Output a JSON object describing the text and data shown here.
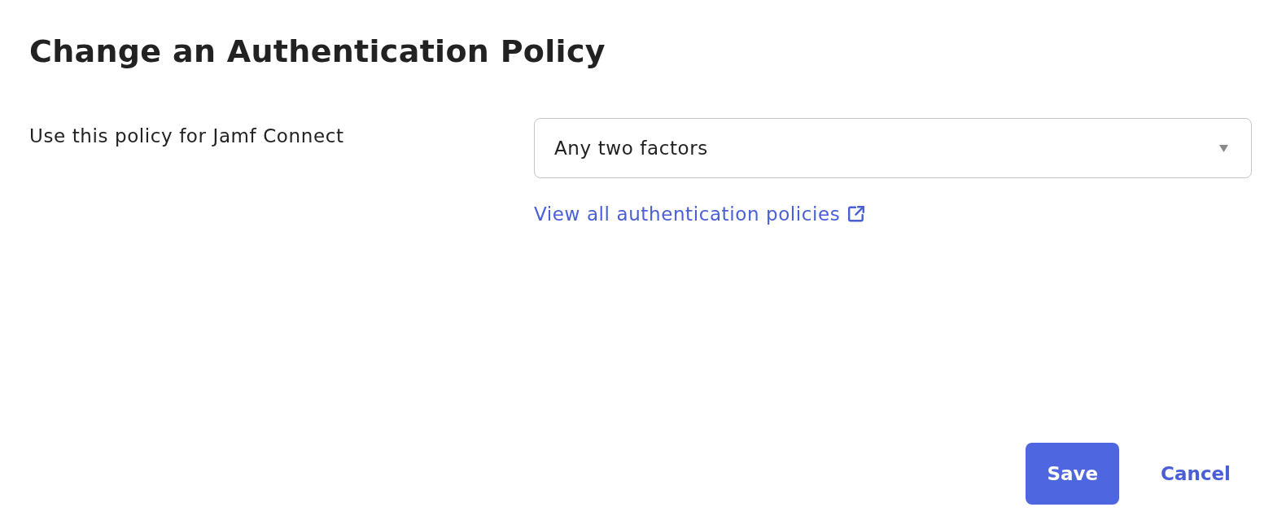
{
  "page": {
    "title": "Change an Authentication Policy"
  },
  "form": {
    "label": "Use this policy for Jamf Connect",
    "select": {
      "value": "Any two factors"
    },
    "link": {
      "text": "View all authentication policies",
      "external": true
    }
  },
  "actions": [
    {
      "label": "Save",
      "kind": "primary"
    },
    {
      "label": "Cancel",
      "kind": "secondary"
    }
  ]
}
